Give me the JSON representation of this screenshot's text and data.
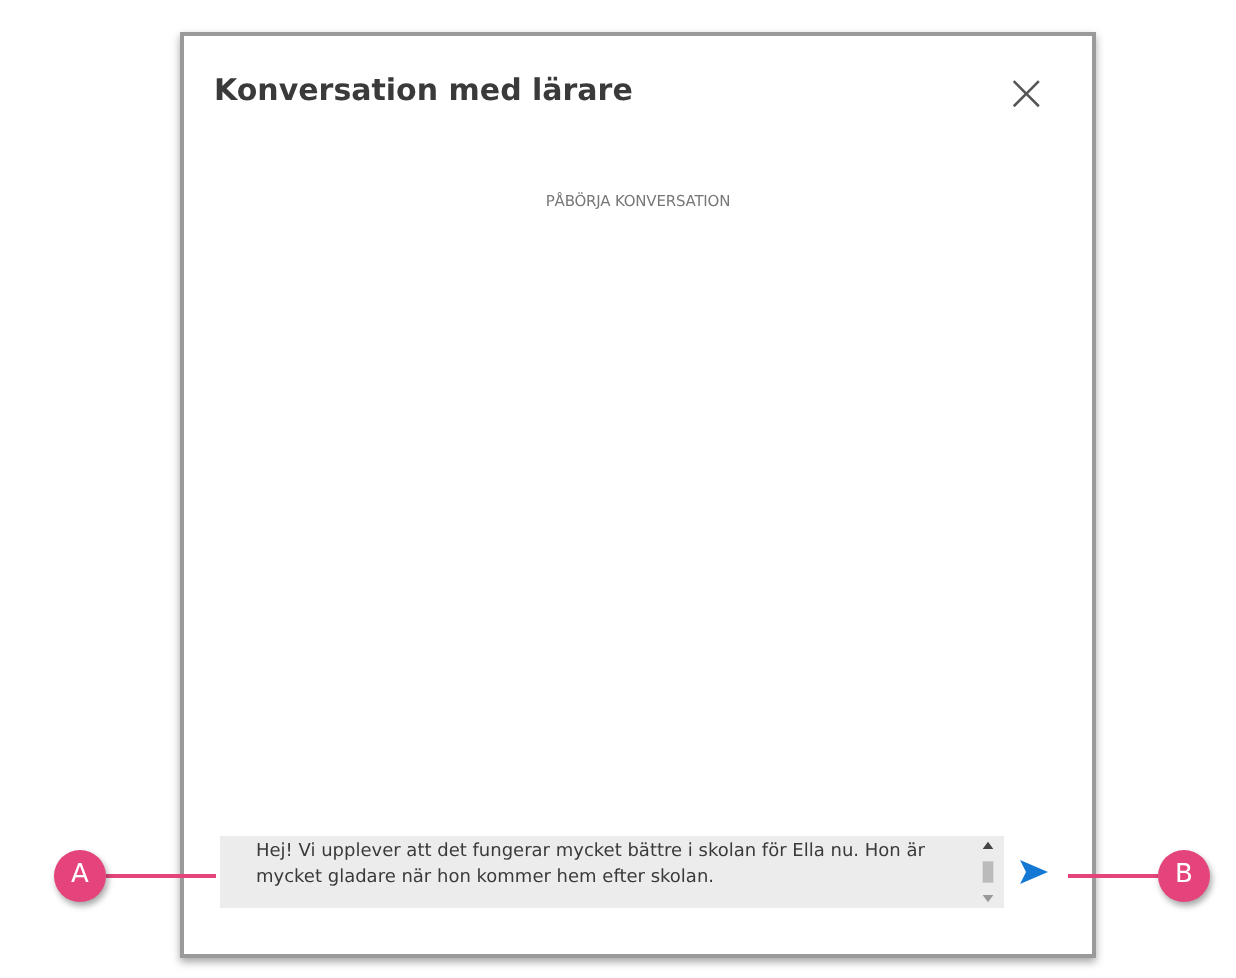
{
  "dialog": {
    "title": "Konversation med lärare",
    "close_symbol": "×",
    "empty_state": "PÅBÖRJA KONVERSATION"
  },
  "composer": {
    "value": "Hej! Vi upplever att det fungerar mycket bättre i skolan för Ella nu. Hon är mycket gladare när hon kommer hem efter skolan."
  },
  "callouts": [
    {
      "label": "A"
    },
    {
      "label": "B"
    }
  ]
}
